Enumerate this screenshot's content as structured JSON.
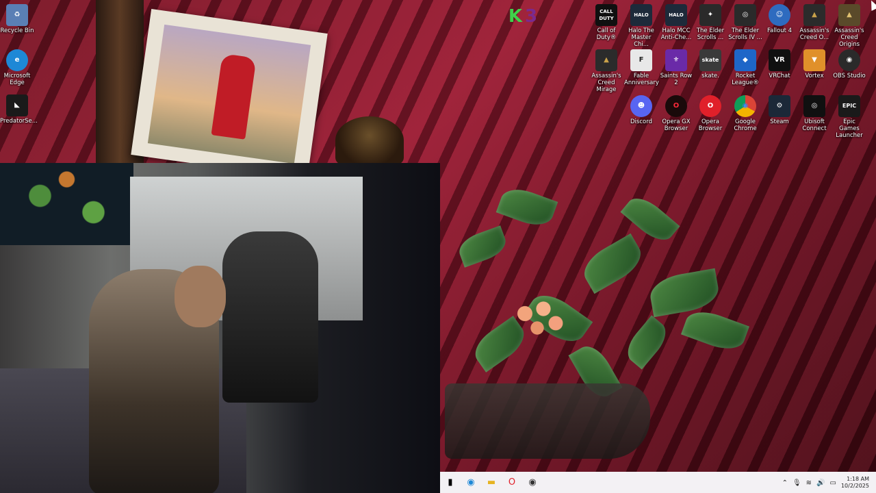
{
  "desktop": {
    "left_icons": [
      {
        "label": "Recycle Bin",
        "icon": "recycle-bin-icon",
        "color": "#5a7fb5"
      },
      {
        "label": "Microsoft Edge",
        "icon": "edge-icon",
        "color": "#1e88d6"
      },
      {
        "label": "PredatorSe...",
        "icon": "predator-sense-icon",
        "color": "#1a1a1a"
      }
    ],
    "row1": [
      {
        "label": "Call of Duty®",
        "icon": "call-of-duty-icon",
        "color": "#101010",
        "glyph": "CALL DUTY"
      },
      {
        "label": "Halo The Master Chi...",
        "icon": "halo-mcc-icon",
        "color": "#1d2a3a",
        "glyph": "HALO"
      },
      {
        "label": "Halo MCC Anti-Che...",
        "icon": "halo-mcc-anticheat-icon",
        "color": "#1d2a3a",
        "glyph": "HALO"
      },
      {
        "label": "The Elder Scrolls ...",
        "icon": "elder-scrolls-icon",
        "color": "#2a2a2a",
        "glyph": "✦"
      },
      {
        "label": "The Elder Scrolls IV ...",
        "icon": "oblivion-icon",
        "color": "#2a2a2a",
        "glyph": "◎"
      },
      {
        "label": "Fallout 4",
        "icon": "fallout-icon",
        "color": "#2e6bbf",
        "glyph": "☺"
      },
      {
        "label": "Assassin's Creed O...",
        "icon": "assassins-creed-odyssey-icon",
        "color": "#2b2b2b",
        "glyph": "▲"
      },
      {
        "label": "Assassin's Creed Origins",
        "icon": "assassins-creed-origins-icon",
        "color": "#5a4a2a",
        "glyph": "▲"
      }
    ],
    "row2": [
      {
        "label": "Assassin's Creed Mirage",
        "icon": "assassins-creed-mirage-icon",
        "color": "#2b2b2b",
        "glyph": "▲"
      },
      {
        "label": "Fable Anniversary",
        "icon": "fable-icon",
        "color": "#e8e8e8",
        "glyph": "F"
      },
      {
        "label": "Saints Row 2",
        "icon": "saints-row-icon",
        "color": "#6a2aa8",
        "glyph": "⚜"
      },
      {
        "label": "skate.",
        "icon": "skate-icon",
        "color": "#3a3a3a",
        "glyph": "skate"
      },
      {
        "label": "Rocket League®",
        "icon": "rocket-league-icon",
        "color": "#1e66c8",
        "glyph": "◆"
      },
      {
        "label": "VRChat",
        "icon": "vrchat-icon",
        "color": "#101010",
        "glyph": "VR"
      },
      {
        "label": "Vortex",
        "icon": "vortex-icon",
        "color": "#e0902a",
        "glyph": "▼"
      },
      {
        "label": "OBS Studio",
        "icon": "obs-icon",
        "color": "#2a2a2a",
        "glyph": "◉"
      }
    ],
    "row3": [
      {
        "label": "Discord",
        "icon": "discord-icon",
        "color": "#5865f2",
        "glyph": "☻"
      },
      {
        "label": "Opera GX Browser",
        "icon": "opera-gx-icon",
        "color": "#1a0a0a",
        "glyph": "O"
      },
      {
        "label": "Opera Browser",
        "icon": "opera-icon",
        "color": "#e0202a",
        "glyph": "O"
      },
      {
        "label": "Google Chrome",
        "icon": "chrome-icon",
        "color": "#2e9e4c",
        "glyph": "◉"
      },
      {
        "label": "Steam",
        "icon": "steam-icon",
        "color": "#1b2838",
        "glyph": "⚙"
      },
      {
        "label": "Ubisoft Connect",
        "icon": "ubisoft-icon",
        "color": "#101010",
        "glyph": "◎"
      },
      {
        "label": "Epic Games Launcher",
        "icon": "epic-games-icon",
        "color": "#1a1a1a",
        "glyph": "EPIC"
      }
    ]
  },
  "overlay": {
    "k3_text": "K",
    "k3_num": "3"
  },
  "taskbar": {
    "buttons": [
      {
        "icon": "task-view-icon",
        "glyph": "▮"
      },
      {
        "icon": "edge-taskbar-icon",
        "glyph": "◉"
      },
      {
        "icon": "file-explorer-icon",
        "glyph": "▬"
      },
      {
        "icon": "opera-taskbar-icon",
        "glyph": "O"
      },
      {
        "icon": "obs-taskbar-icon",
        "glyph": "◉"
      }
    ],
    "clock_time": "1:18 AM",
    "clock_date": "10/2/2025"
  }
}
